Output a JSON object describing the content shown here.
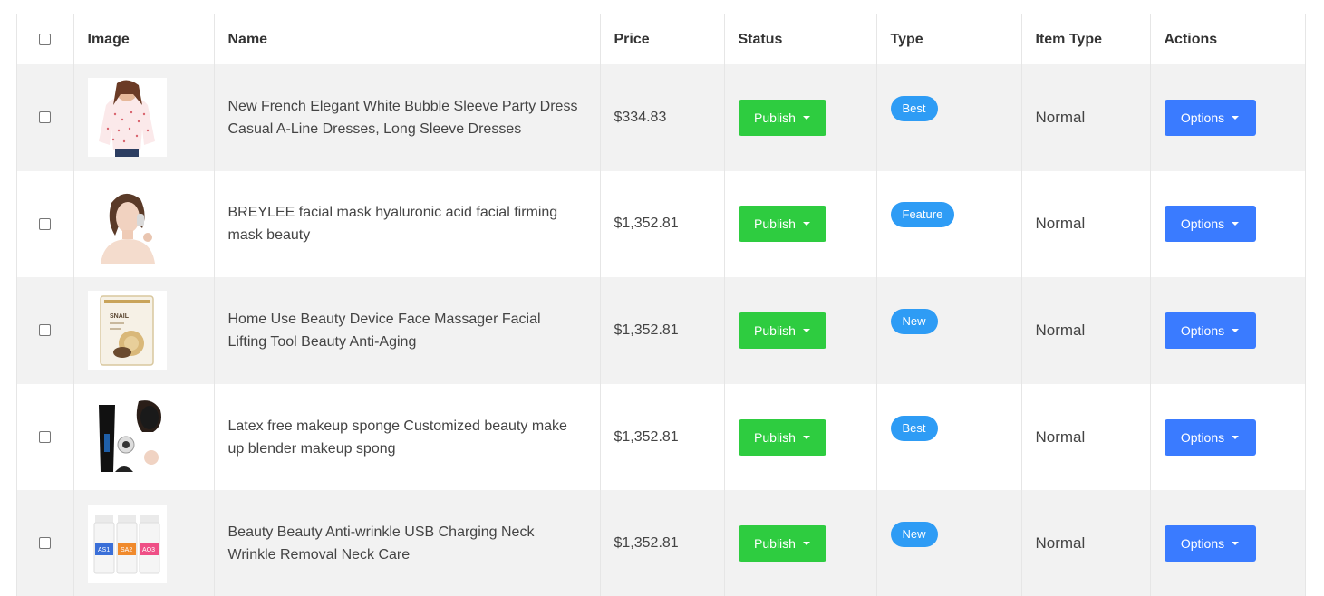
{
  "table": {
    "headers": [
      "Image",
      "Name",
      "Price",
      "Status",
      "Type",
      "Item Type",
      "Actions"
    ],
    "rows": [
      {
        "name": "New French Elegant White Bubble Sleeve Party Dress Casual A-Line Dresses, Long Sleeve Dresses",
        "price": "$334.83",
        "status": "Publish",
        "type": "Best",
        "item_type": "Normal",
        "action": "Options"
      },
      {
        "name": "BREYLEE facial mask hyaluronic acid facial firming mask beauty",
        "price": "$1,352.81",
        "status": "Publish",
        "type": "Feature",
        "item_type": "Normal",
        "action": "Options"
      },
      {
        "name": "Home Use Beauty Device Face Massager Facial Lifting Tool Beauty Anti-Aging",
        "price": "$1,352.81",
        "status": "Publish",
        "type": "New",
        "item_type": "Normal",
        "action": "Options"
      },
      {
        "name": "Latex free makeup sponge Customized beauty make up blender makeup spong",
        "price": "$1,352.81",
        "status": "Publish",
        "type": "Best",
        "item_type": "Normal",
        "action": "Options"
      },
      {
        "name": "Beauty Beauty Anti-wrinkle USB Charging Neck Wrinkle Removal Neck Care",
        "price": "$1,352.81",
        "status": "Publish",
        "type": "New",
        "item_type": "Normal",
        "action": "Options"
      }
    ],
    "product_labels": {
      "mask_pack": "SNAIL",
      "bottles": [
        "AS1",
        "SA2",
        "AO3"
      ]
    }
  },
  "colors": {
    "publish": "#2ecc40",
    "options": "#3a7bff",
    "badge": "#2e9cf5",
    "row_alt": "#f2f2f2"
  }
}
